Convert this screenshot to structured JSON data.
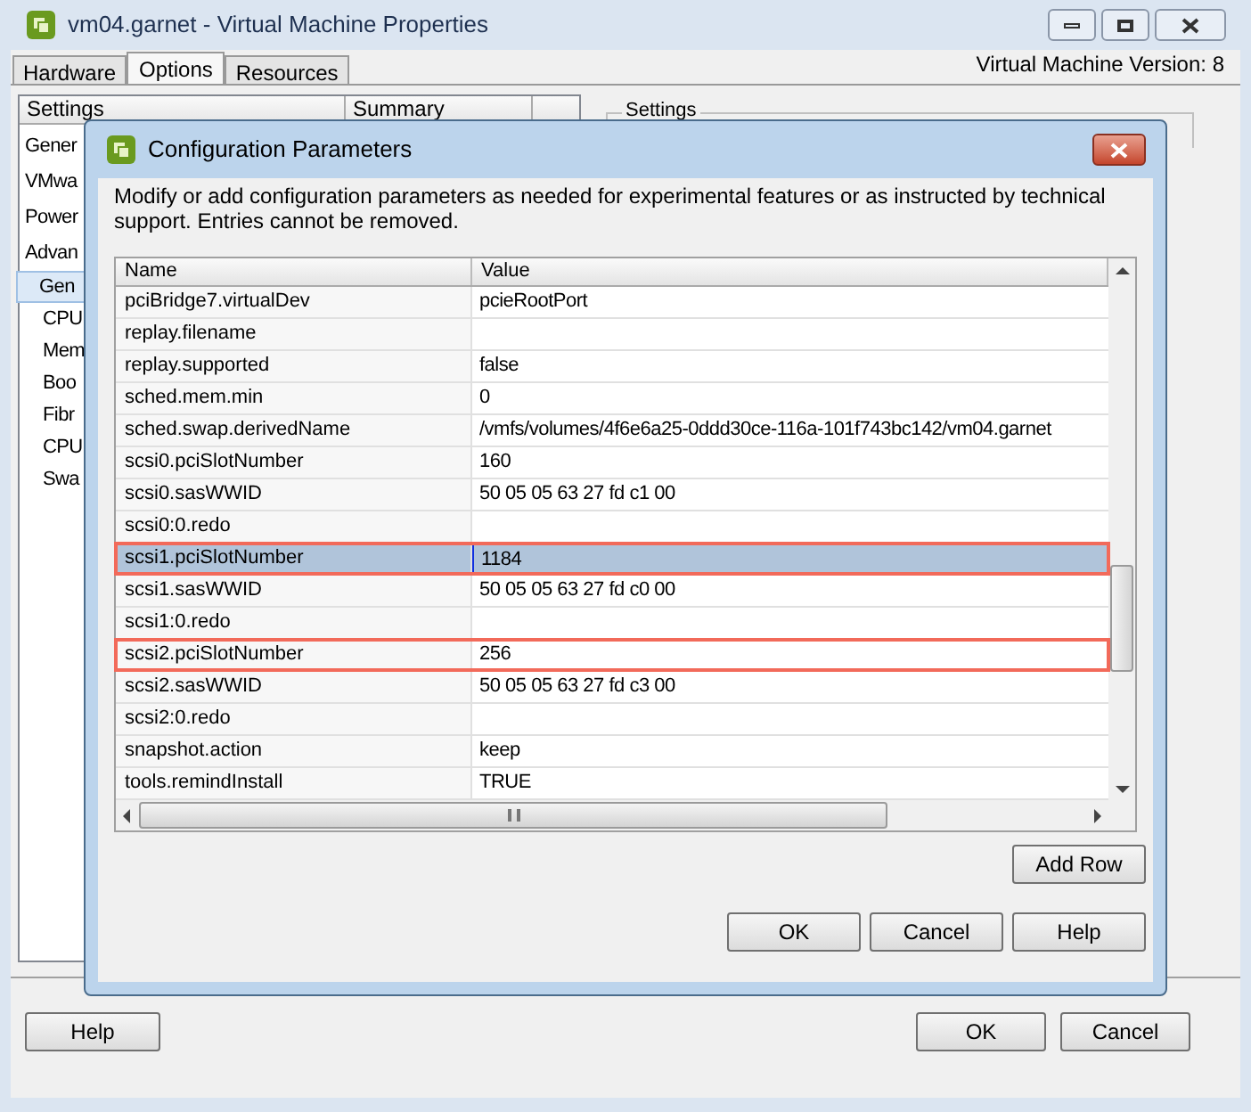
{
  "window": {
    "title": "vm04.garnet - Virtual Machine Properties"
  },
  "tabs": [
    {
      "label": "Hardware",
      "selected": false
    },
    {
      "label": "Options",
      "selected": true
    },
    {
      "label": "Resources",
      "selected": false
    }
  ],
  "version": "Virtual Machine Version: 8",
  "settings_list": {
    "columns": [
      "Settings",
      "Summary"
    ],
    "items": [
      {
        "label": "Gener",
        "selected": false
      },
      {
        "label": "VMwa",
        "selected": false
      },
      {
        "label": "Power",
        "selected": false
      },
      {
        "label": "Advan",
        "selected": false,
        "children": [
          {
            "label": "Gen",
            "selected": true
          },
          {
            "label": "CPU",
            "selected": false
          },
          {
            "label": "Mem",
            "selected": false
          },
          {
            "label": "Boo",
            "selected": false
          },
          {
            "label": "Fibr",
            "selected": false
          },
          {
            "label": "CPU",
            "selected": false
          },
          {
            "label": "Swa",
            "selected": false
          }
        ]
      }
    ]
  },
  "settings_group": {
    "title": "Settings"
  },
  "dialog": {
    "title": "Configuration Parameters",
    "description": "Modify or add configuration parameters as needed for experimental features or as instructed by technical support. Entries cannot be removed.",
    "table": {
      "columns": [
        "Name",
        "Value"
      ],
      "rows": [
        {
          "name": "pciBridge7.virtualDev",
          "value": "pcieRootPort",
          "selected": false,
          "highlighted": false
        },
        {
          "name": "replay.filename",
          "value": "",
          "selected": false,
          "highlighted": false
        },
        {
          "name": "replay.supported",
          "value": "false",
          "selected": false,
          "highlighted": false
        },
        {
          "name": "sched.mem.min",
          "value": "0",
          "selected": false,
          "highlighted": false
        },
        {
          "name": "sched.swap.derivedName",
          "value": "/vmfs/volumes/4f6e6a25-0ddd30ce-116a-101f743bc142/vm04.garnet",
          "selected": false,
          "highlighted": false
        },
        {
          "name": "scsi0.pciSlotNumber",
          "value": "160",
          "selected": false,
          "highlighted": false
        },
        {
          "name": "scsi0.sasWWID",
          "value": "50 05 05 63 27 fd c1 00",
          "selected": false,
          "highlighted": false
        },
        {
          "name": "scsi0:0.redo",
          "value": "",
          "selected": false,
          "highlighted": false
        },
        {
          "name": "scsi1.pciSlotNumber",
          "value": "1184",
          "selected": true,
          "highlighted": true
        },
        {
          "name": "scsi1.sasWWID",
          "value": "50 05 05 63 27 fd c0 00",
          "selected": false,
          "highlighted": false
        },
        {
          "name": "scsi1:0.redo",
          "value": "",
          "selected": false,
          "highlighted": false
        },
        {
          "name": "scsi2.pciSlotNumber",
          "value": "256",
          "selected": false,
          "highlighted": true
        },
        {
          "name": "scsi2.sasWWID",
          "value": "50 05 05 63 27 fd c3 00",
          "selected": false,
          "highlighted": false
        },
        {
          "name": "scsi2:0.redo",
          "value": "",
          "selected": false,
          "highlighted": false
        },
        {
          "name": "snapshot.action",
          "value": "keep",
          "selected": false,
          "highlighted": false
        },
        {
          "name": "tools.remindInstall",
          "value": "TRUE",
          "selected": false,
          "highlighted": false
        }
      ]
    },
    "add_button": "Add Row",
    "buttons": [
      "OK",
      "Cancel",
      "Help"
    ]
  },
  "footer": {
    "left_button": "Help",
    "buttons": [
      "OK",
      "Cancel"
    ]
  }
}
